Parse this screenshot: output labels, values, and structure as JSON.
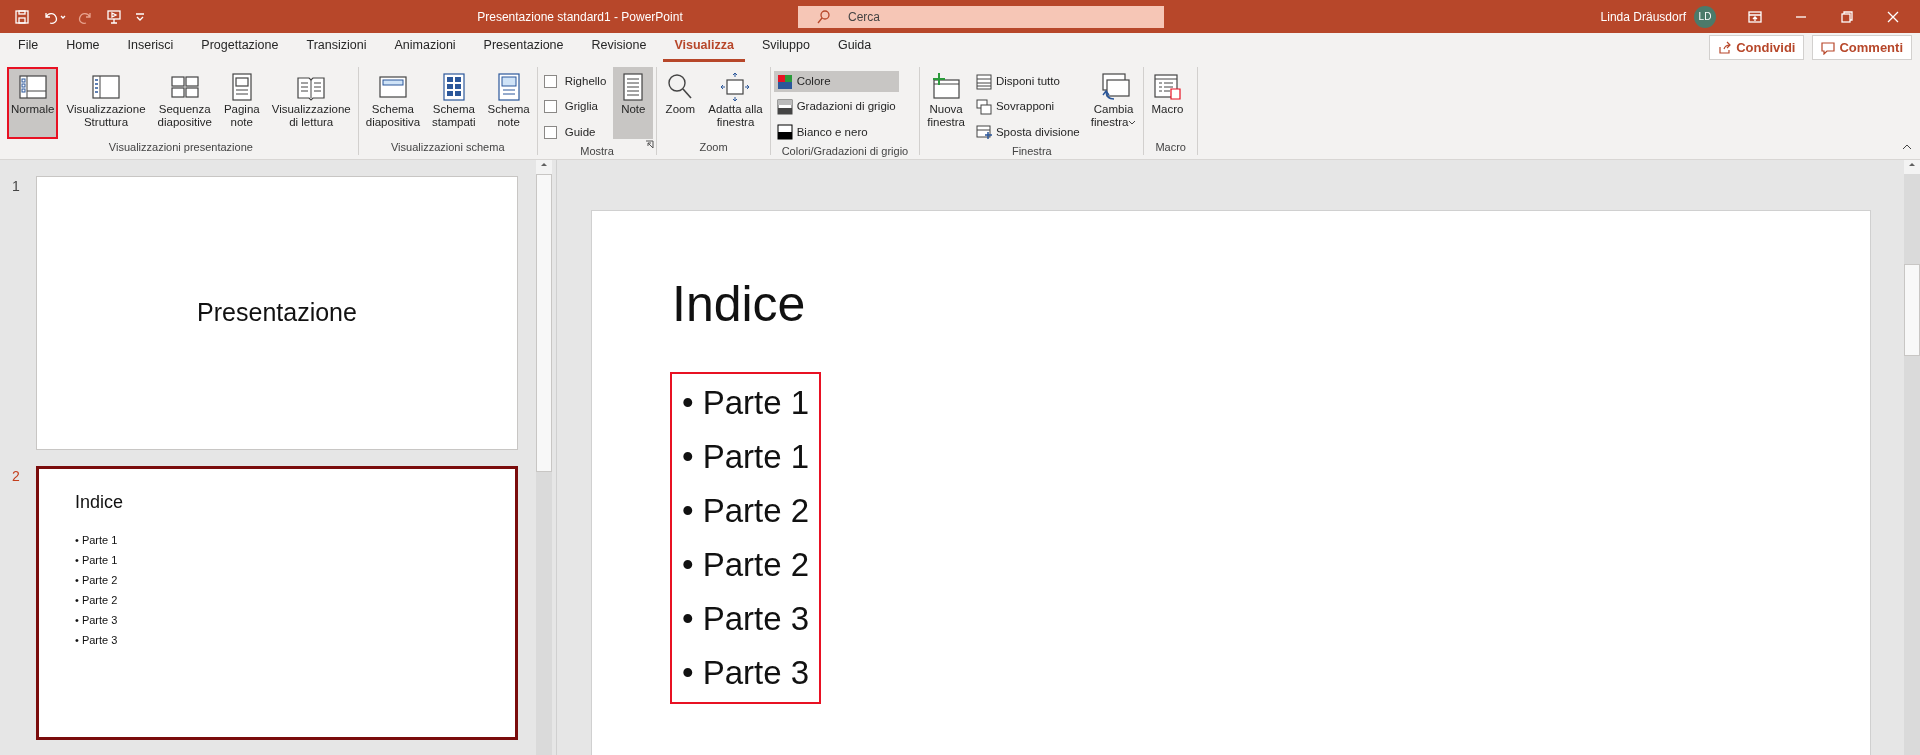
{
  "title_bar": {
    "title": "Presentazione standard1 - PowerPoint",
    "search": {
      "placeholder": "Cerca"
    },
    "user": {
      "name": "Linda Dräusdorf",
      "initials": "LD"
    }
  },
  "ribbon_tabs": [
    {
      "label": "File",
      "selected": false
    },
    {
      "label": "Home",
      "selected": false
    },
    {
      "label": "Inserisci",
      "selected": false
    },
    {
      "label": "Progettazione",
      "selected": false
    },
    {
      "label": "Transizioni",
      "selected": false
    },
    {
      "label": "Animazioni",
      "selected": false
    },
    {
      "label": "Presentazione",
      "selected": false
    },
    {
      "label": "Revisione",
      "selected": false
    },
    {
      "label": "Visualizza",
      "selected": true
    },
    {
      "label": "Sviluppo",
      "selected": false
    },
    {
      "label": "Guida",
      "selected": false
    }
  ],
  "share_buttons": [
    "Condividi",
    "Commenti"
  ],
  "ribbon_groups": [
    {
      "label": "Visualizzazioni presentazione",
      "items": [
        {
          "kind": "large",
          "label": "Normale",
          "selected": true,
          "highlighted": true
        },
        {
          "kind": "large",
          "label": "Visualizzazione\nStruttura",
          "selected": false,
          "highlighted": false
        },
        {
          "kind": "large",
          "label": "Sequenza\ndiapositive",
          "selected": false,
          "highlighted": false
        },
        {
          "kind": "large",
          "label": "Pagina\nnote",
          "selected": false,
          "highlighted": false
        },
        {
          "kind": "large",
          "label": "Visualizzazione\ndi lettura",
          "selected": false,
          "highlighted": false
        }
      ]
    },
    {
      "label": "Visualizzazioni schema",
      "items": [
        {
          "kind": "large",
          "label": "Schema\ndiapositiva",
          "selected": false,
          "highlighted": false
        },
        {
          "kind": "large",
          "label": "Schema\nstampati",
          "selected": false,
          "highlighted": false
        },
        {
          "kind": "large",
          "label": "Schema\nnote",
          "selected": false,
          "highlighted": false
        }
      ]
    },
    {
      "label": "Mostra",
      "dialog_launcher": true,
      "items": [
        {
          "kind": "check",
          "label": "Righello",
          "checked": false
        },
        {
          "kind": "check",
          "label": "Griglia",
          "checked": false
        },
        {
          "kind": "check",
          "label": "Guide",
          "checked": false
        },
        {
          "kind": "large",
          "label": "Note",
          "selected": true,
          "highlighted": false
        }
      ]
    },
    {
      "label": "Zoom",
      "items": [
        {
          "kind": "large",
          "label": "Zoom",
          "selected": false,
          "highlighted": false
        },
        {
          "kind": "large",
          "label": "Adatta alla\nfinestra",
          "selected": false,
          "highlighted": false
        }
      ]
    },
    {
      "label": "Colori/Gradazioni di grigio",
      "items": [
        {
          "kind": "small",
          "label": "Colore",
          "selected": true
        },
        {
          "kind": "small",
          "label": "Gradazioni di grigio",
          "selected": false
        },
        {
          "kind": "small",
          "label": "Bianco e nero",
          "selected": false
        }
      ]
    },
    {
      "label": "Finestra",
      "items": [
        {
          "kind": "large",
          "label": "Nuova\nfinestra",
          "selected": false,
          "highlighted": false
        },
        {
          "kind": "small",
          "label": "Disponi tutto",
          "selected": false
        },
        {
          "kind": "small",
          "label": "Sovrapponi",
          "selected": false
        },
        {
          "kind": "small",
          "label": "Sposta divisione",
          "selected": false
        },
        {
          "kind": "large",
          "label": "Cambia\nfinestra",
          "selected": false,
          "highlighted": false,
          "dropdown": true
        }
      ]
    },
    {
      "label": "Macro",
      "items": [
        {
          "kind": "large",
          "label": "Macro",
          "selected": false,
          "highlighted": false
        }
      ]
    }
  ],
  "slides": [
    {
      "number": "1",
      "selected": false,
      "kind": "title",
      "title": "Presentazione"
    },
    {
      "number": "2",
      "selected": true,
      "kind": "list",
      "title": "Indice",
      "bullets": [
        "• Parte 1",
        "• Parte 1",
        "• Parte 2",
        "• Parte 2",
        "• Parte 3",
        "• Parte 3"
      ]
    }
  ],
  "editor": {
    "title": "Indice",
    "bullets": [
      "• Parte 1",
      "• Parte 1",
      "• Parte 2",
      "• Parte 2",
      "• Parte 3",
      "• Parte 3"
    ],
    "highlighted": true
  }
}
